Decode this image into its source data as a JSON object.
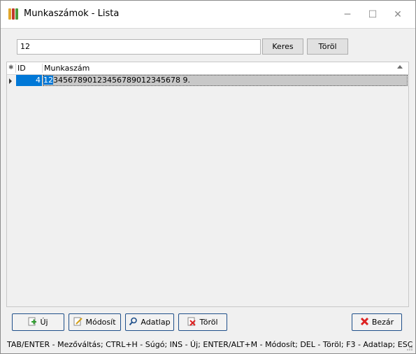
{
  "window": {
    "title": "Munkaszámok - Lista",
    "minimize": "─",
    "maximize": "☐",
    "close": "✕"
  },
  "search": {
    "value": "12",
    "search_button": "Keres",
    "clear_button": "Töröl"
  },
  "grid": {
    "header_marker": "✱",
    "columns": [
      "ID",
      "Munkaszám"
    ],
    "rows": [
      {
        "id": "4",
        "munkaszam_highlight": "12",
        "munkaszam_rest": "34567890123456789012345678 9."
      }
    ]
  },
  "buttons": {
    "new": "Új",
    "modify": "Módosít",
    "datasheet": "Adatlap",
    "delete": "Töröl",
    "close": "Bezár"
  },
  "status": {
    "text": "TAB/ENTER - Mezőváltás; CTRL+H - Súgó; INS - Új; ENTER/ALT+M - Módosít; DEL - Töröl; F3 - Adatlap; ESC"
  },
  "colors": {
    "selection": "#0078d7",
    "button_border": "#1f4f8a"
  }
}
